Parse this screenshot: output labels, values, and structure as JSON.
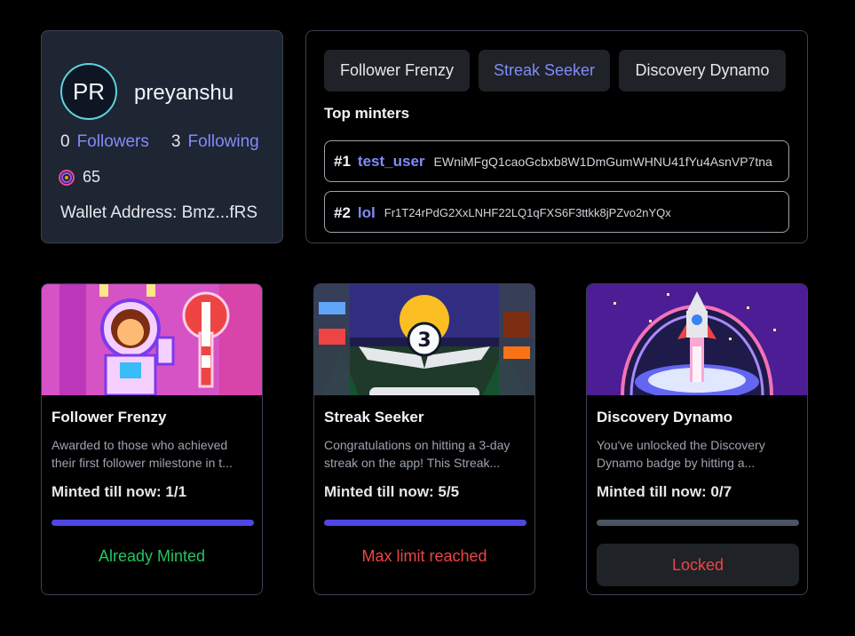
{
  "profile": {
    "avatar_initials": "PR",
    "username": "preyanshu",
    "followers_count": "0",
    "followers_label": "Followers",
    "following_count": "3",
    "following_label": "Following",
    "points": "65",
    "points_icon": "coin-icon",
    "wallet": "Wallet Address: Bmz...fRS"
  },
  "tabs": [
    {
      "label": "Follower Frenzy",
      "active": false
    },
    {
      "label": "Streak Seeker",
      "active": true
    },
    {
      "label": "Discovery Dynamo",
      "active": false
    }
  ],
  "top_minters": {
    "title": "Top minters",
    "rows": [
      {
        "rank": "#1",
        "name": "test_user",
        "address": "EWniMFgQ1caoGcbxb8W1DmGumWHNU41fYu4AsnVP7tna"
      },
      {
        "rank": "#2",
        "name": "lol",
        "address": "Fr1T24rPdG2XxLNHF22LQ1qFXS6F3ttkk8jPZvo2nYQx"
      }
    ]
  },
  "badges": [
    {
      "title": "Follower Frenzy",
      "desc_line1": "Awarded to those who achieved",
      "desc_line2": "their first follower milestone in t...",
      "minted": "Minted till now: 1/1",
      "progress": 1.0,
      "status": "Already Minted",
      "status_color": "#22c55e",
      "image_label": "pixel-astronaut-image"
    },
    {
      "title": "Streak Seeker",
      "desc_line1": "Congratulations on hitting a 3-day",
      "desc_line2": "streak on the app! This Streak...",
      "minted": "Minted till now: 5/5",
      "progress": 1.0,
      "status": "Max limit reached",
      "status_color": "#ef4444",
      "image_label": "pixel-streak-emblem-image"
    },
    {
      "title": "Discovery Dynamo",
      "desc_line1": "You've unlocked the Discovery",
      "desc_line2": "Dynamo badge by hitting a...",
      "minted": "Minted till now: 0/7",
      "progress": 0.0,
      "status": "Locked",
      "status_color": "#ef4444",
      "image_label": "pixel-rocket-image"
    }
  ],
  "colors": {
    "accent": "#818cf8",
    "progress": "#4f46e5",
    "success": "#22c55e",
    "danger": "#ef4444",
    "avatar_ring": "#5fd3e0"
  }
}
